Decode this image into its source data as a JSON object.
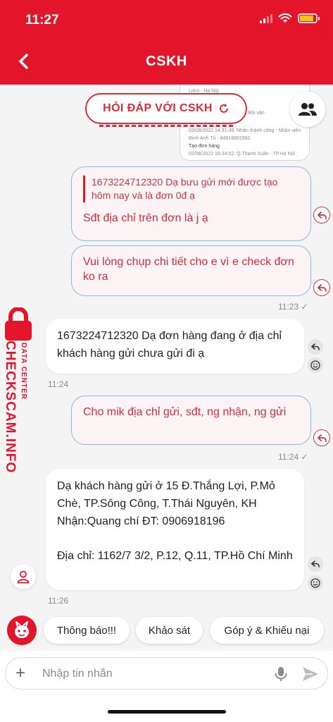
{
  "status_bar": {
    "time": "11:27"
  },
  "header": {
    "title": "CSKH"
  },
  "quoted_image": {
    "lines": [
      "Liêm - Hà Nội",
      "03/08/2022 ...:57: Nhận tại Bội vận",
      "03/08/2022 14:31:49: Nhận thành công - Nhân viên",
      "Đinh Anh Tú - 84918801992",
      "Tạo đơn hàng",
      "02/08/2022 16:34:02: Q.Thanh Xuân - TP.Hà Nội"
    ]
  },
  "stamp": {
    "text": "HỎI ĐÁP VỚI CSKH"
  },
  "messages": [
    {
      "id": "m1",
      "quote": "1673224712320  Dạ bưu gửi mới được tạo hôm nay và là đơn 0đ ạ",
      "text": "Sđt địa chỉ trên đơn là j ạ"
    },
    {
      "id": "m2",
      "text": "Vui lòng chụp chi tiết cho e vì e check đơn ko ra",
      "time": "11:23 ✓"
    },
    {
      "id": "m3",
      "text": "1673224712320   Dạ đơn hàng đang ở địa chỉ khách hàng gửi chưa gửi đi ạ",
      "time": "11:24"
    },
    {
      "id": "m4",
      "text": "Cho mik địa chỉ gửi, sđt, ng nhận, ng gửi",
      "time": "11:24 ✓"
    },
    {
      "id": "m5",
      "text1": "Dạ khách hàng gửi ở 15 Đ.Thắng Lợi, P.Mỏ Chè, TP.Sông Công, T.Thái Nguyên, KH Nhận:Quang chí ĐT: 0906918196",
      "text2": "Địa chỉ: 1162/7 3/2, P.12, Q.11, TP.Hồ Chí Minh",
      "time": "11:26"
    }
  ],
  "watermark": {
    "main": "CHECKSCAM.INFO",
    "sub": "DATA CENTER"
  },
  "quick_replies": [
    "Thông báo!!!",
    "Khảo sát",
    "Góp ý & Khiếu nại"
  ],
  "composer": {
    "placeholder": "Nhập tin nhắn",
    "plus": "+"
  },
  "colors": {
    "brand_red": "#e3152b",
    "out_border": "#8fb5e6"
  }
}
